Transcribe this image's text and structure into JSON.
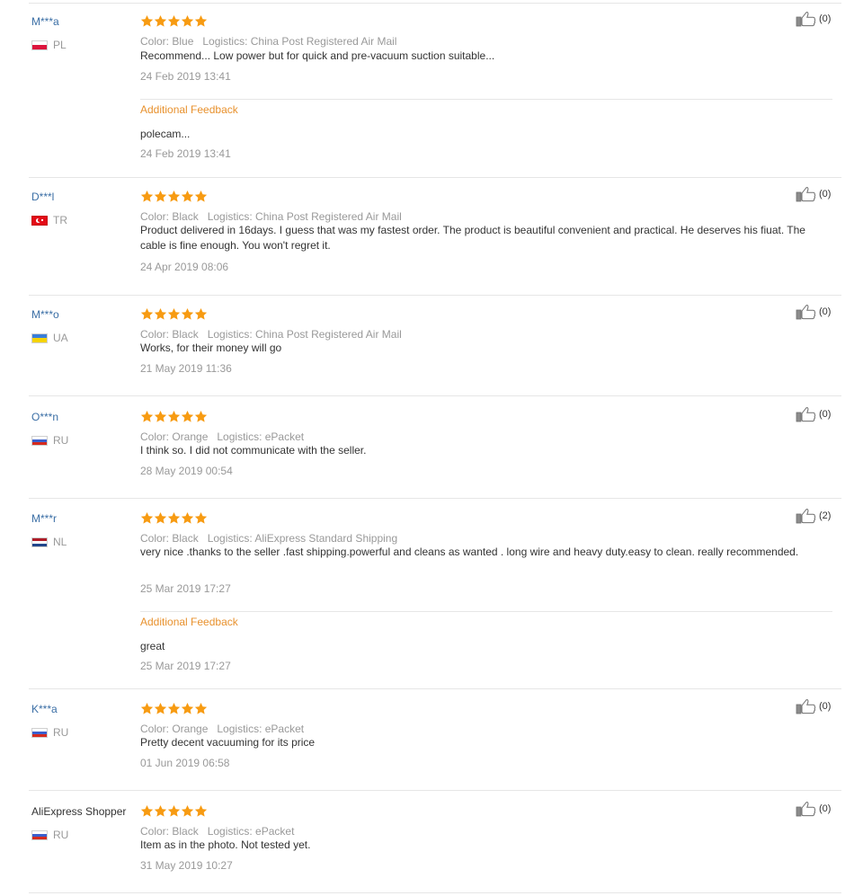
{
  "colors": {
    "star": "#f79b12",
    "link": "#3a6ea5",
    "feedback_label": "#e8912d",
    "muted": "#999999"
  },
  "reviews": [
    {
      "user": "M***a",
      "country": "PL",
      "flag": "pl",
      "stars": 5,
      "color": "Color: Blue",
      "logistics": "Logistics: China Post Registered Air Mail",
      "text": "Recommend... Low power but for quick and pre-vacuum suction suitable...",
      "date": "24 Feb 2019 13:41",
      "additional": {
        "label": "Additional Feedback",
        "text": "polecam...",
        "date": "24 Feb 2019 13:41"
      },
      "helpful": "(0)"
    },
    {
      "user": "D***l",
      "country": "TR",
      "flag": "tr",
      "stars": 5,
      "color": "Color: Black",
      "logistics": "Logistics: China Post Registered Air Mail",
      "text": "Product delivered in 16days. I guess that was my fastest order. The product is beautiful convenient and practical. He deserves his fiuat. The cable is fine enough. You won't regret it.",
      "date": "24 Apr 2019 08:06",
      "helpful": "(0)"
    },
    {
      "user": "M***o",
      "country": "UA",
      "flag": "ua",
      "stars": 5,
      "color": "Color: Black",
      "logistics": "Logistics: China Post Registered Air Mail",
      "text": "Works, for their money will go",
      "date": "21 May 2019 11:36",
      "helpful": "(0)"
    },
    {
      "user": "O***n",
      "country": "RU",
      "flag": "ru",
      "stars": 5,
      "color": "Color: Orange",
      "logistics": "Logistics: ePacket",
      "text": "I think so. I did not communicate with the seller.",
      "date": "28 May 2019 00:54",
      "helpful": "(0)"
    },
    {
      "user": "M***r",
      "country": "NL",
      "flag": "nl",
      "stars": 5,
      "color": "Color: Black",
      "logistics": "Logistics: AliExpress Standard Shipping",
      "text": "very nice .thanks to the seller .fast shipping.powerful and cleans as wanted . long wire and heavy duty.easy to clean. really recommended.",
      "date": "25 Mar 2019 17:27",
      "additional": {
        "label": "Additional Feedback",
        "text": "great",
        "date": "25 Mar 2019 17:27"
      },
      "helpful": "(2)"
    },
    {
      "user": "K***a",
      "country": "RU",
      "flag": "ru",
      "stars": 5,
      "color": "Color: Orange",
      "logistics": "Logistics: ePacket",
      "text": "Pretty decent vacuuming for its price",
      "date": "01 Jun 2019 06:58",
      "helpful": "(0)"
    },
    {
      "user": "AliExpress Shopper",
      "country": "RU",
      "flag": "ru",
      "stars": 5,
      "color": "Color: Black",
      "logistics": "Logistics: ePacket",
      "text": "Item as in the photo. Not tested yet.",
      "date": "31 May 2019 10:27",
      "helpful": "(0)"
    }
  ]
}
